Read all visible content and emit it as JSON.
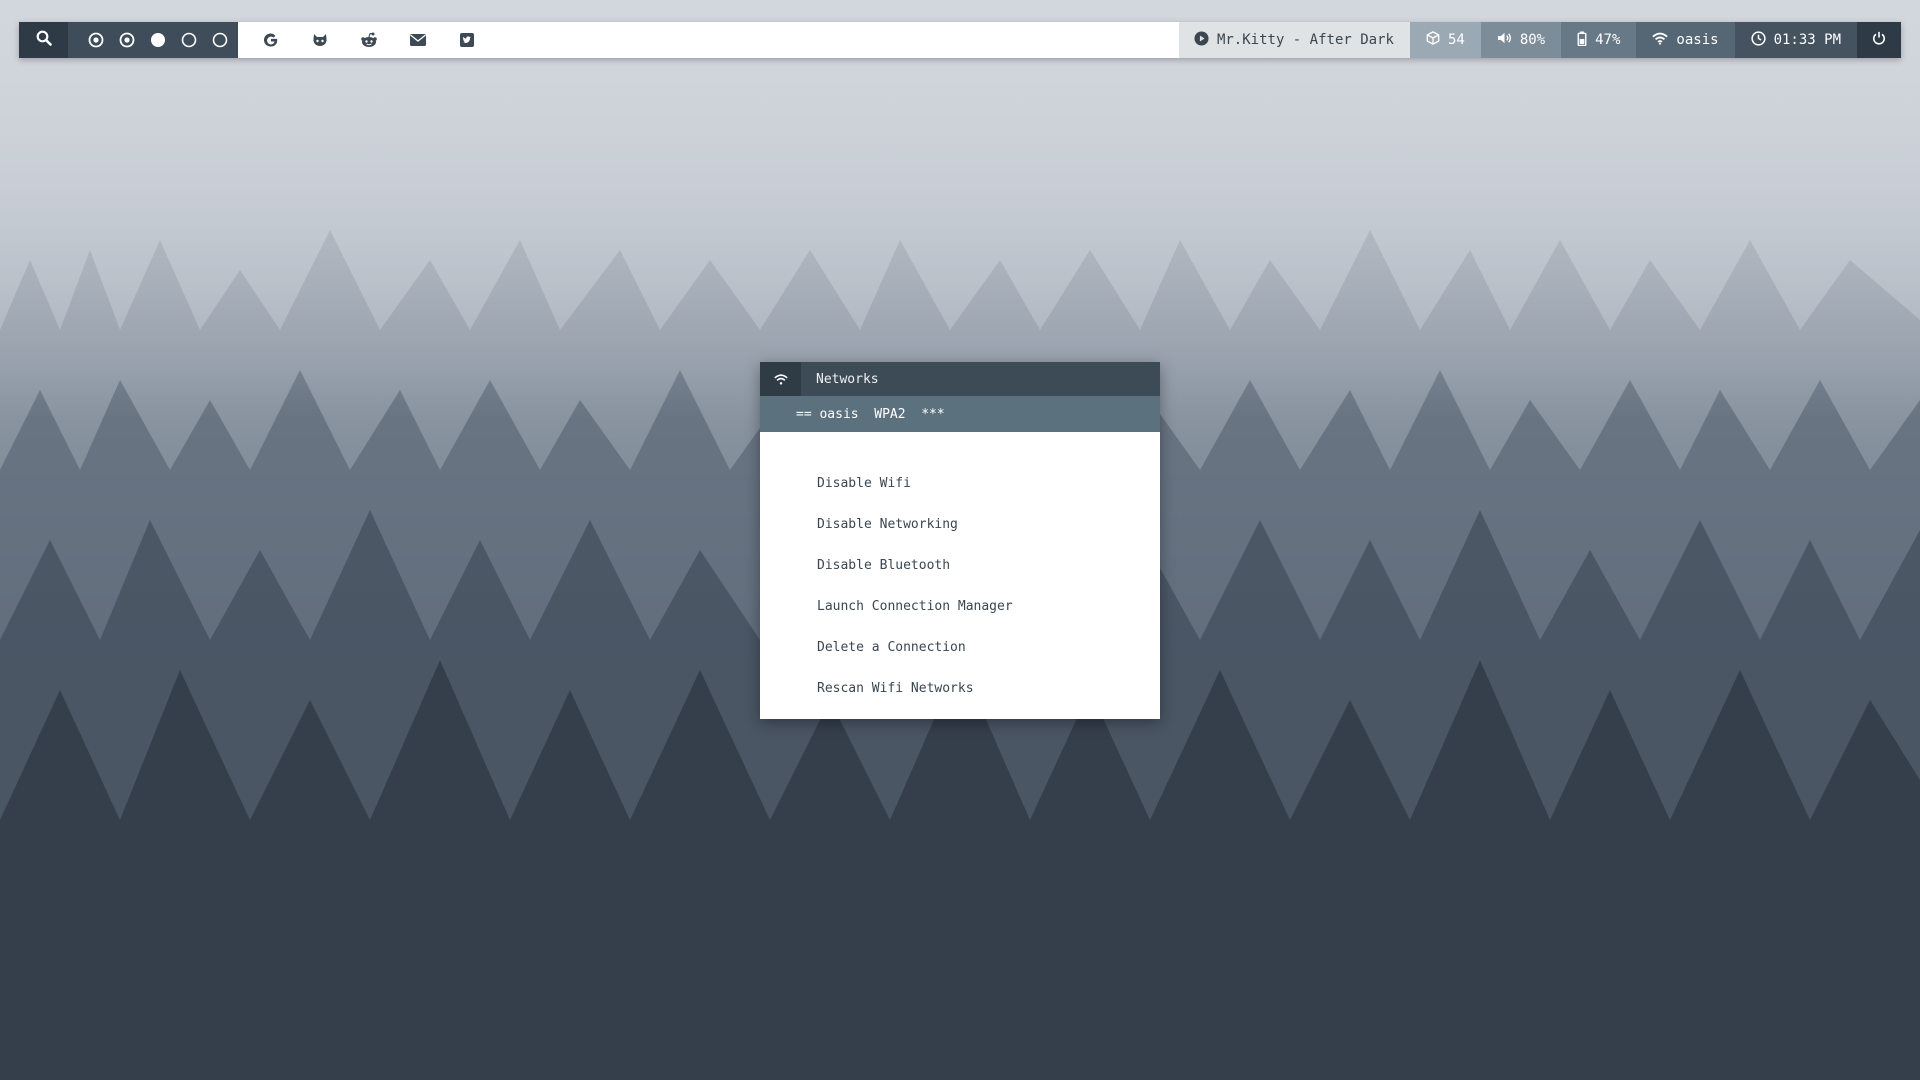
{
  "topbar": {
    "search_icon": "search-icon",
    "workspaces": [
      {
        "state": "dotted-circle"
      },
      {
        "state": "dotted-circle"
      },
      {
        "state": "filled-circle"
      },
      {
        "state": "empty-circle"
      },
      {
        "state": "empty-circle"
      }
    ],
    "launchers": [
      "google-icon",
      "github-icon",
      "reddit-icon",
      "mail-icon",
      "twitter-icon"
    ],
    "music": {
      "icon": "play-icon",
      "text": "Mr.Kitty - After Dark"
    },
    "packages": {
      "icon": "package-icon",
      "text": "54"
    },
    "volume": {
      "icon": "volume-icon",
      "text": "80%"
    },
    "battery": {
      "icon": "battery-icon",
      "text": "47%"
    },
    "wifi": {
      "icon": "wifi-icon",
      "text": "oasis"
    },
    "clock": {
      "icon": "clock-icon",
      "text": "01:33 PM"
    },
    "power_icon": "power-icon"
  },
  "network_menu": {
    "title": "Networks",
    "selected_entry": "== oasis  WPA2  ***",
    "items": [
      "Disable Wifi",
      "Disable Networking",
      "Disable Bluetooth",
      "Launch Connection Manager",
      "Delete a Connection",
      "Rescan Wifi Networks"
    ]
  },
  "colors": {
    "bar_dark": "#2e3b47",
    "bar_mid": "#3e4d59",
    "popup_header": "#3d4b56",
    "popup_selected": "#5b727e",
    "text_dark": "#3b4650"
  }
}
